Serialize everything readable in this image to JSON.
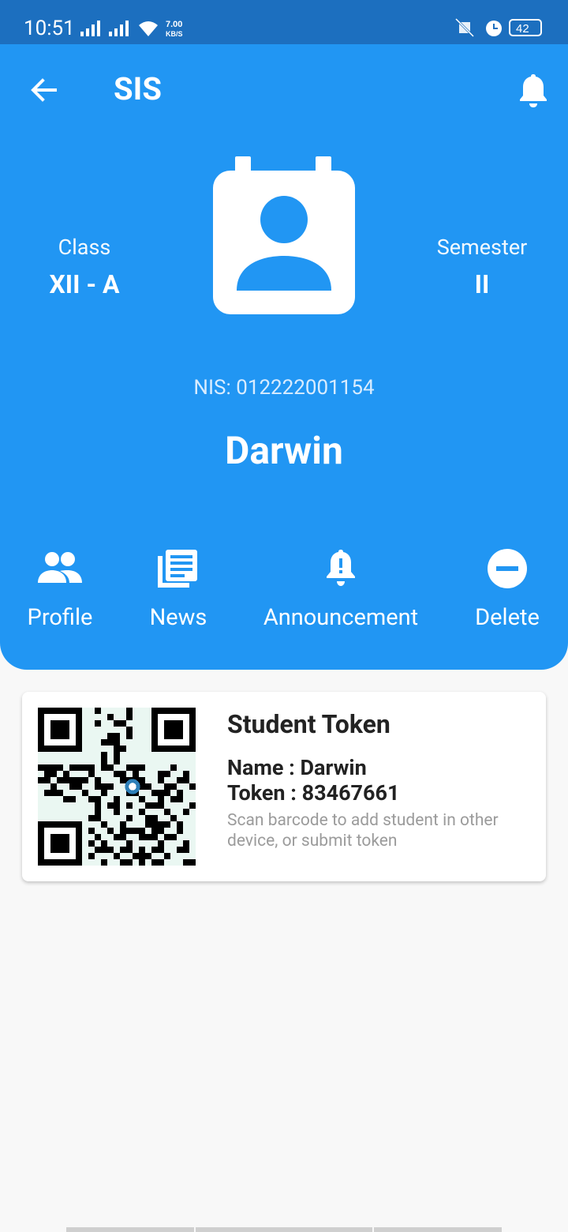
{
  "status_bar": {
    "time": "10:51",
    "net_speed_value": "7.00",
    "net_speed_unit": "KB/S",
    "battery": "42"
  },
  "app_bar": {
    "title": "SIS"
  },
  "student": {
    "class_label": "Class",
    "class_value": "XII - A",
    "semester_label": "Semester",
    "semester_value": "II",
    "nis": "NIS: 012222001154",
    "name": "Darwin"
  },
  "actions": [
    {
      "label": "Profile",
      "icon": "people-icon"
    },
    {
      "label": "News",
      "icon": "news-icon"
    },
    {
      "label": "Announcement",
      "icon": "announcement-icon"
    },
    {
      "label": "Delete",
      "icon": "minus-circle-icon"
    }
  ],
  "token_card": {
    "title": "Student Token",
    "name_line": "Name : Darwin",
    "token_line": "Token : 83467661",
    "hint": "Scan barcode to add student in other device, or submit token"
  },
  "colors": {
    "primary": "#2196f3",
    "status_bar": "#1c6fbf",
    "background": "#f8f8f8"
  }
}
